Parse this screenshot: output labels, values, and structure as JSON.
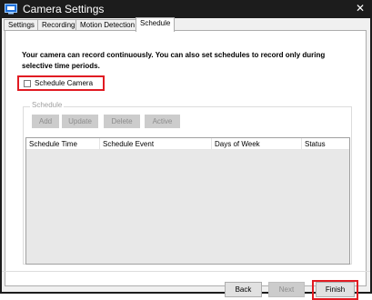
{
  "window": {
    "title": "Camera Settings",
    "icon": "camera-settings-icon",
    "close_glyph": "✕"
  },
  "tabs": [
    {
      "label": "Settings",
      "active": false
    },
    {
      "label": "Recording",
      "active": false
    },
    {
      "label": "Motion Detection",
      "active": false
    },
    {
      "label": "Schedule",
      "active": true
    }
  ],
  "intro_text": "Your camera can record continuously. You can also set schedules to record only during selective time periods.",
  "schedule_camera": {
    "label": "Schedule Camera",
    "checked": false
  },
  "schedule_group": {
    "title": "Schedule",
    "buttons": [
      "Add",
      "Update",
      "Delete",
      "Active"
    ],
    "columns": [
      "Schedule Time",
      "Schedule Event",
      "Days of Week",
      "Status"
    ],
    "rows": []
  },
  "footer": {
    "back": "Back",
    "next": "Next",
    "finish": "Finish"
  },
  "colors": {
    "highlight": "#e11b22",
    "titlebar": "#1c1c1c",
    "disabled_button": "#cccccc"
  }
}
